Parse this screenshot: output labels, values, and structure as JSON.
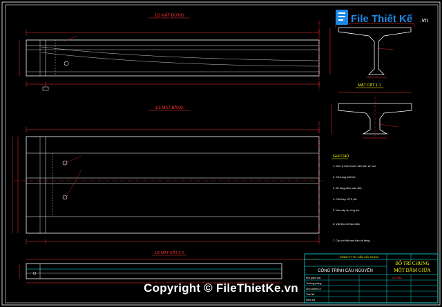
{
  "drawing": {
    "view_titles": {
      "elevation": "1/2 MẶT ĐỨNG",
      "plan": "1/2 MẶT BẰNG",
      "section": "MẶT CẮT 1-1",
      "bottom_section": "1/2 MẶT CẮT 2-2"
    },
    "notes_title": "GHI CHÚ",
    "notes": [
      "1. Đơn vị kích thước trên bản vẽ: cm.",
      "2. Tải trọng thiết kế.",
      "3. Bê tông dầm mác 400.",
      "4. Cốt thép: CT3, AII.",
      "5. Neo cáp dự ứng lực.",
      "6. Vật liệu chế tạo dầm.",
      "7. Các chi tiết xem bản vẽ riêng."
    ]
  },
  "title_block": {
    "company": "CÔNG TY TƯ VẤN XÂY DỰNG",
    "project": "CÔNG TRÌNH CẦU NGUYỄN",
    "drawing_title_line1": "BỐ TRÍ CHUNG",
    "drawing_title_line2": "MỘT DẦM GIỮA",
    "drawing_number_label": "SỐ HIỆU",
    "rows": [
      {
        "role": "Phó giám đốc",
        "name": ""
      },
      {
        "role": "Trưởng phòng",
        "name": ""
      },
      {
        "role": "Chủ nhiệm CT",
        "name": ""
      },
      {
        "role": "Thiết kế",
        "name": ""
      },
      {
        "role": "Kiểm tra",
        "name": ""
      }
    ]
  },
  "watermark": {
    "logo_text": "File Thiết Kế",
    "logo_suffix": ".vn",
    "copyright": "Copyright © FileThietKe.vn"
  },
  "colors": {
    "background": "#000000",
    "line": "#ffffff",
    "dimension": "#ff3030",
    "accent": "#ffff00",
    "section": "#00ffff",
    "brand": "#1e88e5"
  }
}
